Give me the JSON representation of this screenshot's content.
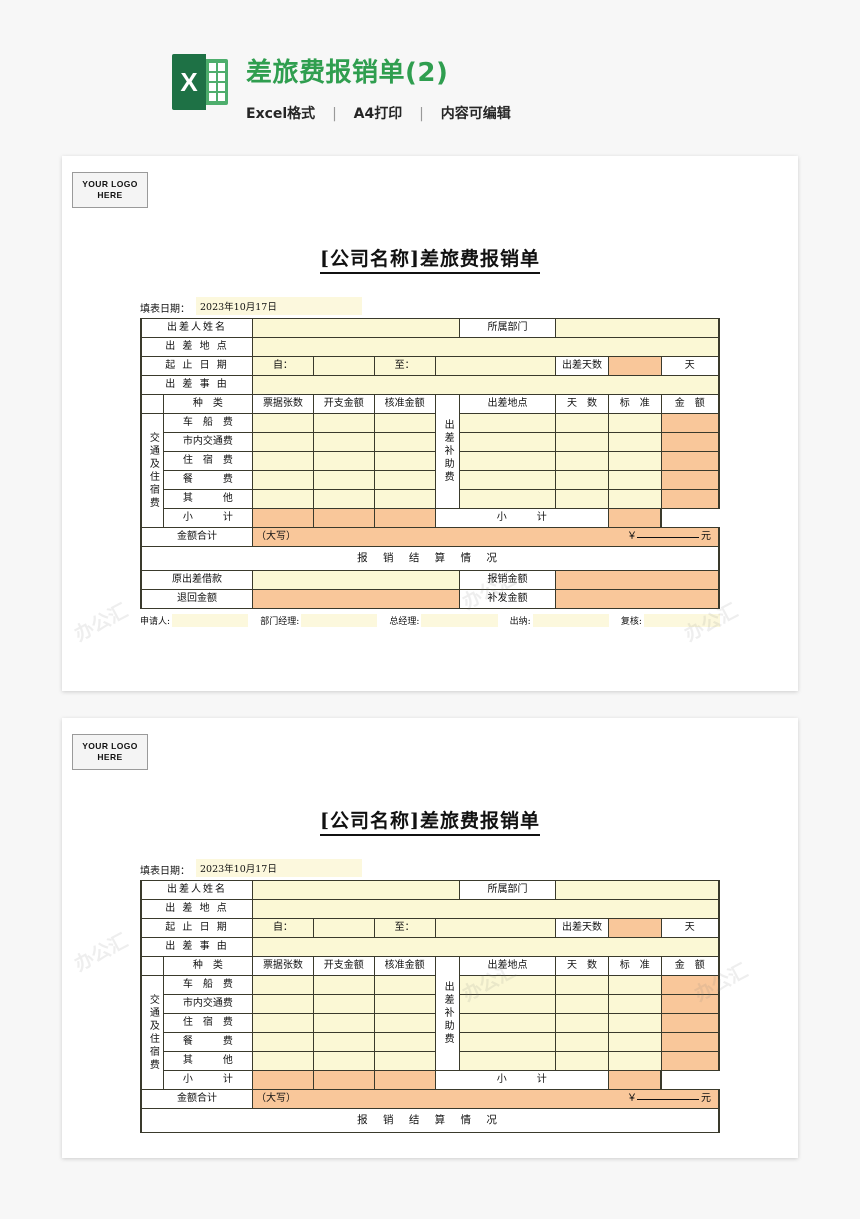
{
  "header": {
    "icon_name": "excel-file-icon",
    "title": "差旅费报销单(2)",
    "meta": {
      "format": "Excel格式",
      "print": "A4打印",
      "editable": "内容可编辑",
      "separator": "|"
    },
    "accent_color": "#2f9e4f"
  },
  "form": {
    "logo_placeholder_line1": "YOUR LOGO",
    "logo_placeholder_line2": "HERE",
    "title": "[公司名称]差旅费报销单",
    "fill_date_label": "填表日期：",
    "fill_date_value": "2023年10月17日",
    "info": {
      "traveler_label": "出差人姓名",
      "department_label": "所属部门",
      "place_label": "出 差 地 点",
      "daterange_label": "起 止 日 期",
      "from_label": "自：",
      "to_label": "至：",
      "days_label": "出差天数",
      "days_unit": "天",
      "reason_label": "出 差 事 由",
      "traveler_value": "",
      "department_value": "",
      "place_value": "",
      "from_value": "",
      "to_value": "",
      "days_value": "",
      "reason_value": ""
    },
    "expense": {
      "group_label": "交通及住宿费",
      "headers": [
        "种　类",
        "票据张数",
        "开支金额",
        "核准金额"
      ],
      "rows": [
        {
          "name": "车　船　费",
          "tickets": "",
          "spend": "",
          "approved": ""
        },
        {
          "name": "市内交通费",
          "tickets": "",
          "spend": "",
          "approved": ""
        },
        {
          "name": "住　宿　费",
          "tickets": "",
          "spend": "",
          "approved": ""
        },
        {
          "name": "餐　　　费",
          "tickets": "",
          "spend": "",
          "approved": ""
        },
        {
          "name": "其　　　他",
          "tickets": "",
          "spend": "",
          "approved": ""
        }
      ],
      "subtotal_label": "小　　　计",
      "subtotal": {
        "tickets": "",
        "spend": "",
        "approved": ""
      }
    },
    "allowance": {
      "group_label": "出差补助费",
      "headers": [
        "出差地点",
        "天　数",
        "标　准",
        "金　额"
      ],
      "rows": [
        {
          "place": "",
          "days": "",
          "standard": "",
          "amount": ""
        },
        {
          "place": "",
          "days": "",
          "standard": "",
          "amount": ""
        },
        {
          "place": "",
          "days": "",
          "standard": "",
          "amount": ""
        },
        {
          "place": "",
          "days": "",
          "standard": "",
          "amount": ""
        },
        {
          "place": "",
          "days": "",
          "standard": "",
          "amount": ""
        }
      ],
      "subtotal_label": "小　　　计",
      "subtotal_amount": ""
    },
    "total": {
      "label": "金额合计",
      "uppercase_label": "（大写）",
      "uppercase_value": "",
      "currency_symbol": "￥",
      "unit": "元",
      "amount_value": ""
    },
    "settlement": {
      "title": "报 销 结 算 情 况",
      "rows": [
        {
          "left_label": "原出差借款",
          "left_value": "",
          "right_label": "报销金额",
          "right_value": ""
        },
        {
          "left_label": "退回金额",
          "left_value": "",
          "right_label": "补发金额",
          "right_value": ""
        }
      ]
    },
    "signatures": [
      {
        "label": "申请人:",
        "value": ""
      },
      {
        "label": "部门经理:",
        "value": ""
      },
      {
        "label": "总经理:",
        "value": ""
      },
      {
        "label": "出纳:",
        "value": ""
      },
      {
        "label": "复核:",
        "value": ""
      }
    ]
  },
  "watermark": {
    "text": "办公汇"
  }
}
